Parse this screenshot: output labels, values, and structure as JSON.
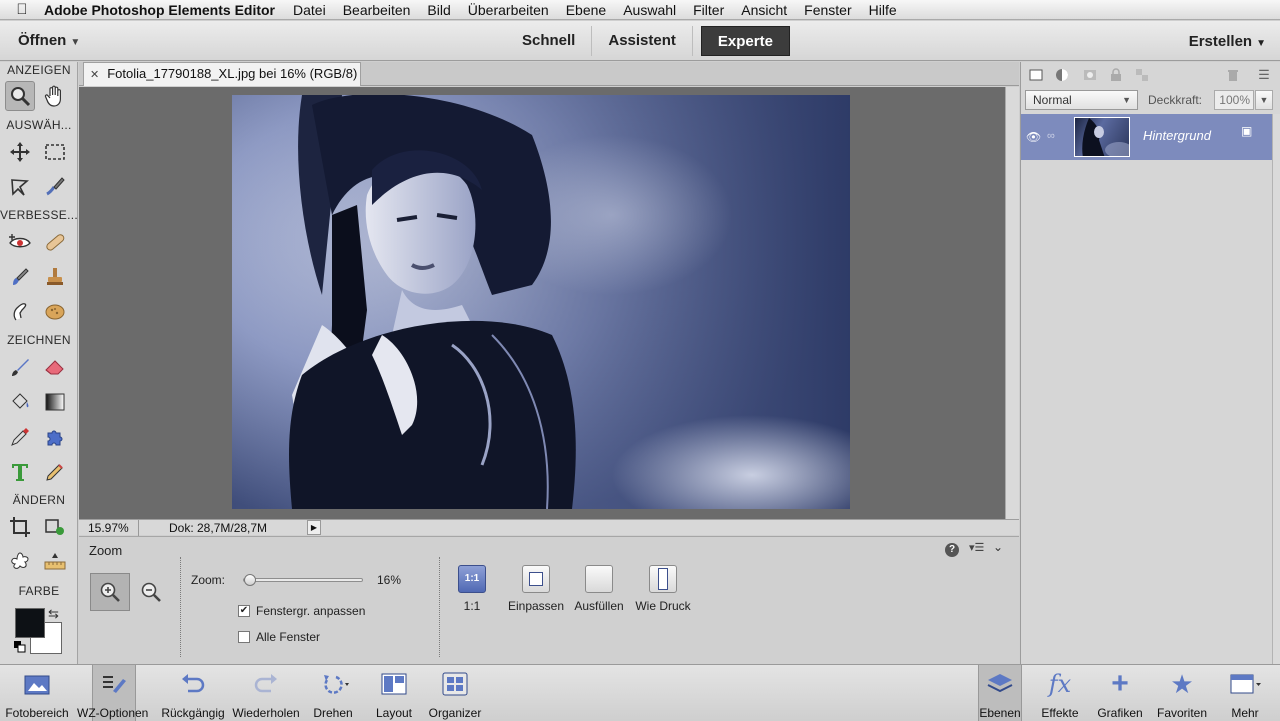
{
  "menubar": {
    "app_name": "Adobe Photoshop Elements Editor",
    "items": [
      "Datei",
      "Bearbeiten",
      "Bild",
      "Überarbeiten",
      "Ebene",
      "Auswahl",
      "Filter",
      "Ansicht",
      "Fenster",
      "Hilfe"
    ]
  },
  "modebar": {
    "open_label": "Öffnen",
    "tabs": [
      "Schnell",
      "Assistent",
      "Experte"
    ],
    "active_tab": "Experte",
    "create_label": "Erstellen"
  },
  "toolbox": {
    "sections": {
      "view": "ANZEIGEN",
      "select": "AUSWÄH...",
      "enhance": "VERBESSE...",
      "draw": "ZEICHNEN",
      "modify": "ÄNDERN",
      "color": "FARBE"
    },
    "foreground_color": "#0d1115",
    "background_color": "#ffffff"
  },
  "document": {
    "tab_title": "Fotolia_17790188_XL.jpg bei 16% (RGB/8)",
    "status_zoom": "15.97%",
    "status_doc": "Dok: 28,7M/28,7M"
  },
  "tool_options": {
    "title": "Zoom",
    "zoom_label": "Zoom:",
    "zoom_value": "16%",
    "zoom_fraction": 0.16,
    "resize_windows_label": "Fenstergr. anpassen",
    "resize_windows_checked": true,
    "all_windows_label": "Alle Fenster",
    "all_windows_checked": false,
    "view_buttons": [
      "1:1",
      "Einpassen",
      "Ausfüllen",
      "Wie Druck"
    ],
    "one_to_one_icon_text": "1:1"
  },
  "layers_panel": {
    "blend_mode": "Normal",
    "opacity_label": "Deckkraft:",
    "opacity_value": "100%",
    "layer_name": "Hintergrund",
    "selected_color": "#7d8bbd"
  },
  "taskbar": {
    "left": [
      "Fotobereich",
      "WZ-Optionen",
      "Rückgängig",
      "Wiederholen",
      "Drehen",
      "Layout",
      "Organizer"
    ],
    "right": [
      "Ebenen",
      "Effekte",
      "Grafiken",
      "Favoriten",
      "Mehr"
    ]
  }
}
